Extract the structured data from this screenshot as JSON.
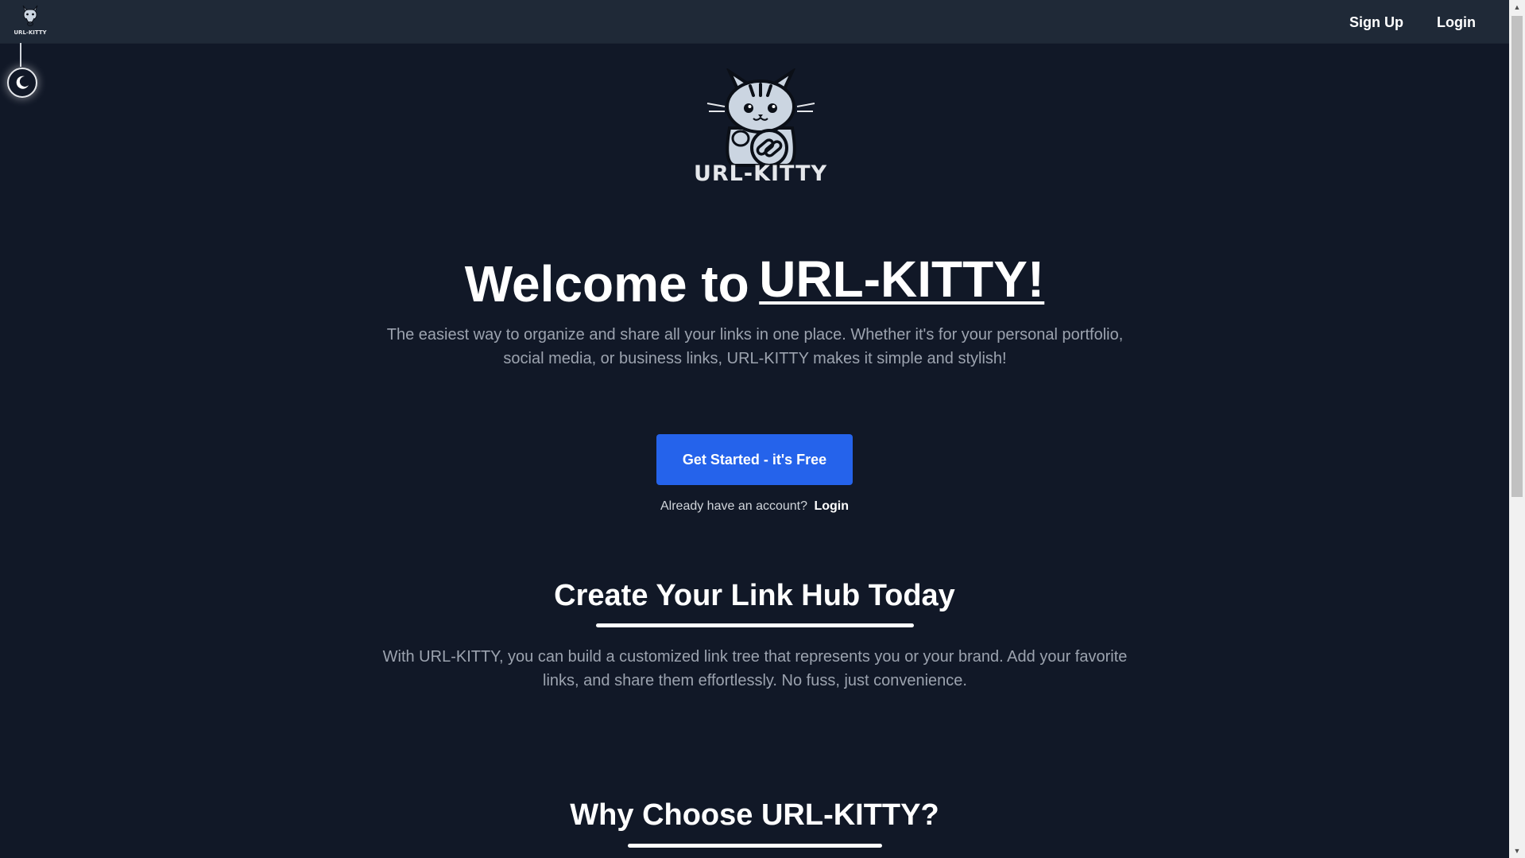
{
  "nav": {
    "logo_text": "URL-KITTY",
    "signup_label": "Sign Up",
    "login_label": "Login"
  },
  "theme_toggle": {
    "icon": "moon-icon"
  },
  "hero": {
    "logo_text": "URL-KITTY",
    "welcome_prefix": "Welcome to",
    "welcome_brand": "URL-KITTY!",
    "description": "The easiest way to organize and share all your links in one place. Whether it's for your personal portfolio, social media, or business links, URL-KITTY makes it simple and stylish!",
    "cta_label": "Get Started - it's Free",
    "already_text": "Already have an account?",
    "already_login": "Login"
  },
  "sections": {
    "create_title": "Create Your Link Hub Today",
    "create_desc": "With URL-KITTY, you can build a customized link tree that represents you or your brand. Add your favorite links, and share them effortlessly. No fuss, just convenience.",
    "why_title": "Why Choose URL-KITTY?"
  },
  "colors": {
    "background": "#111827",
    "navbar": "#1f2937",
    "accent": "#2563eb",
    "muted_text": "#9ca3af"
  }
}
